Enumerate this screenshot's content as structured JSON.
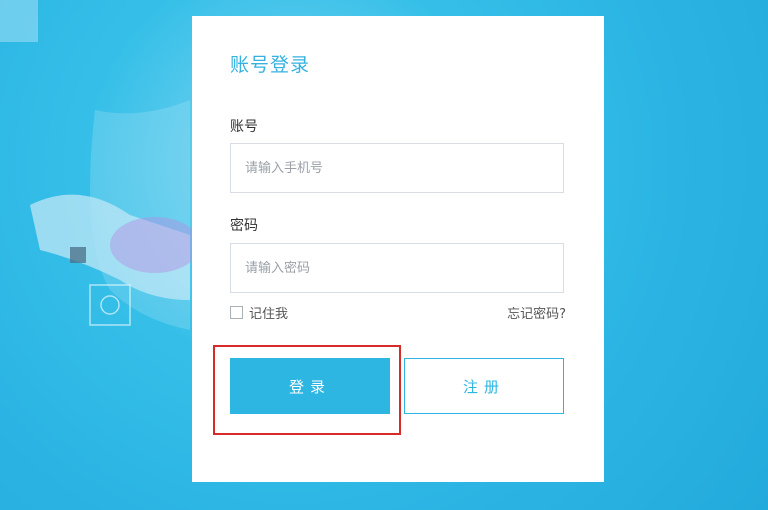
{
  "login": {
    "title": "账号登录",
    "account_label": "账号",
    "account_placeholder": "请输入手机号",
    "password_label": "密码",
    "password_placeholder": "请输入密码",
    "remember_label": "记住我",
    "forgot_label": "忘记密码?",
    "login_button": "登录",
    "register_button": "注册"
  },
  "colors": {
    "accent": "#2eb6e3",
    "background": "#2bb4e3",
    "highlight": "#d92a2a"
  }
}
